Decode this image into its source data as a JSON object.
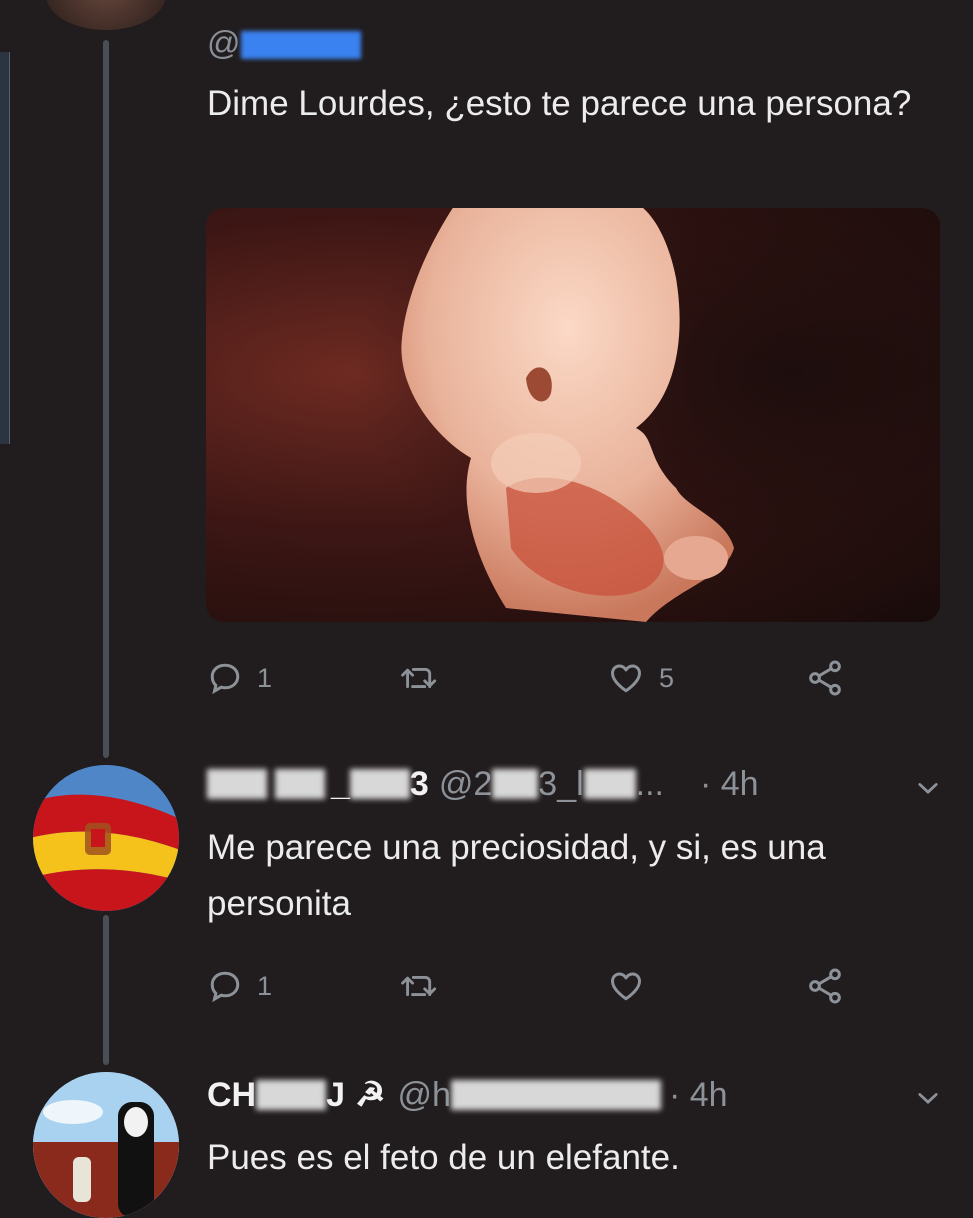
{
  "thread": {
    "tweet1": {
      "handle": "@",
      "text": "Dime Lourdes, ¿esto te parece una persona?",
      "replies": "1",
      "retweets": "",
      "likes": "5"
    },
    "tweet2": {
      "name": "_",
      "name_end": "3",
      "handle": "@2",
      "handle_end": "3_l",
      "handle_ellipsis": "...",
      "time": "· 4h",
      "text": "Me parece una preciosidad, y si, es una personita",
      "replies": "1",
      "retweets": "",
      "likes": ""
    },
    "tweet3": {
      "name": "CH",
      "name_mid": "J",
      "name_symbol": "☭",
      "handle": "@h",
      "time": "· 4h",
      "text": "Pues es el feto de un elefante."
    }
  },
  "colors": {
    "background": "#211c1d",
    "text": "#ececec",
    "secondary": "#8d9299",
    "thread_line": "#4a4e55",
    "redaction": "#3a82f0"
  },
  "icons": [
    "reply-icon",
    "retweet-icon",
    "like-icon",
    "share-icon",
    "chevron-down-icon",
    "hammer-sickle-icon"
  ]
}
